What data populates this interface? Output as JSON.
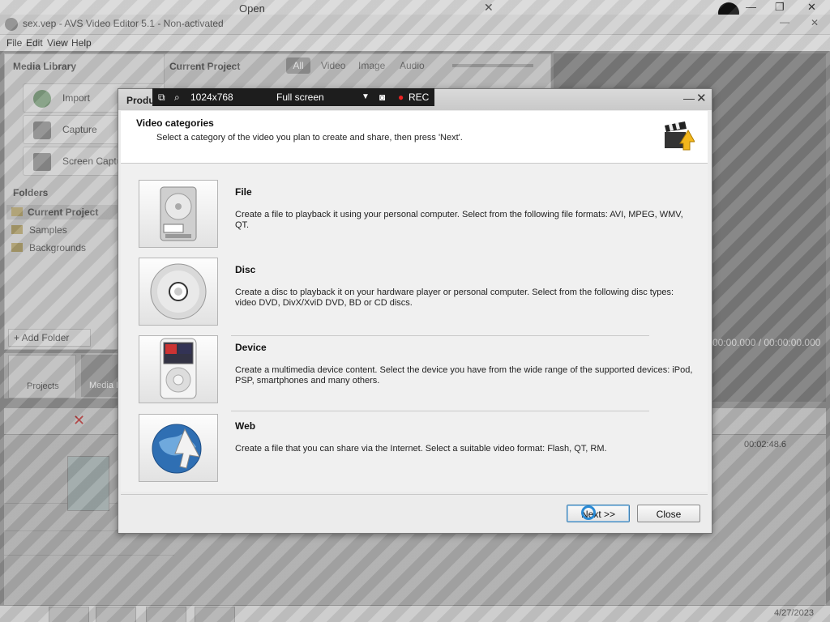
{
  "browser": {
    "tab_title": "Open",
    "close_glyph": "✕"
  },
  "window": {
    "title": "sex.vep - AVS Video Editor 5.1 - Non-activated"
  },
  "menu": {
    "items": [
      "File",
      "Edit",
      "View",
      "Help"
    ]
  },
  "left_panel": {
    "media_library_label": "Media Library",
    "buttons": [
      "Import",
      "Capture",
      "Screen Captu"
    ],
    "folders_label": "Folders",
    "folders": [
      "Current Project",
      "Samples",
      "Backgrounds"
    ],
    "add_folder_label": "+ Add Folder"
  },
  "project_area": {
    "title": "Current Project",
    "filters": [
      "All",
      "Video",
      "Image",
      "Audio"
    ]
  },
  "bottom_tabs": [
    "Projects",
    "Media L"
  ],
  "preview": {
    "timecode": "00:00.000 / 00:00:00.000"
  },
  "timeline": {
    "timecode": "00:02:48.6"
  },
  "taskbar": {
    "date": "4/27/2023"
  },
  "recorder": {
    "resolution": "1024x768",
    "mode": "Full screen",
    "rec_label": "REC"
  },
  "dialog": {
    "title": "Produ",
    "header_title": "Video categories",
    "header_subtitle": "Select a category of the video you plan to create and share, then press 'Next'.",
    "categories": [
      {
        "title": "File",
        "icon": "hard-drive-icon",
        "description": "Create a file to playback it using your personal computer. Select from the following file formats: AVI, MPEG, WMV, QT."
      },
      {
        "title": "Disc",
        "icon": "disc-icon",
        "description": "Create a disc to playback it on your hardware player or personal computer. Select from the following disc types: video DVD, DivX/XviD DVD, BD or CD discs."
      },
      {
        "title": "Device",
        "icon": "ipod-icon",
        "description": "Create a multimedia device content. Select the device you have from the wide range of the supported devices: iPod, PSP, smartphones and many others."
      },
      {
        "title": "Web",
        "icon": "globe-icon",
        "description": "Create a file that you can share via the Internet. Select a suitable video format: Flash, QT, RM."
      }
    ],
    "next_label": "Next >>",
    "close_label": "Close"
  }
}
